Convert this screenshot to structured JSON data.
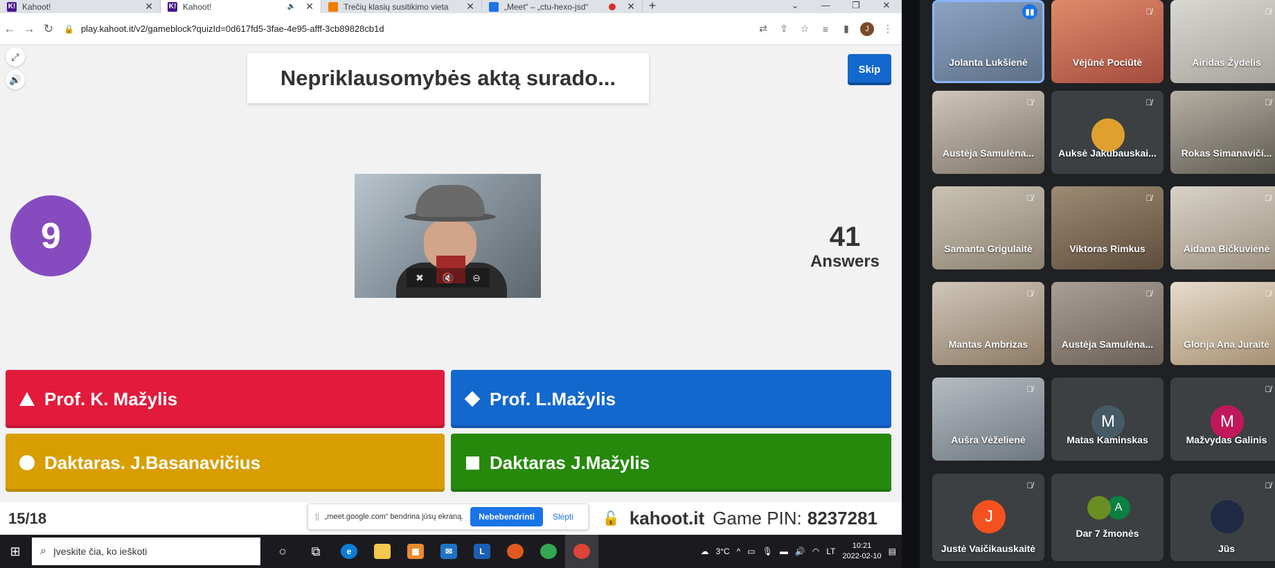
{
  "browser": {
    "tabs": [
      {
        "label": "Kahoot!",
        "favicon": "K!",
        "active": false
      },
      {
        "label": "Kahoot!",
        "favicon": "K!",
        "active": true
      },
      {
        "label": "Trečių klasių susitikimo vieta",
        "favicon": "orange-square-icon",
        "active": false
      },
      {
        "label": "„Meet“ – „ctu-hexo-jsd“",
        "favicon": "meet-icon",
        "active": false
      }
    ],
    "url": "play.kahoot.it/v2/gameblock?quizId=0d617fd5-3fae-4e95-afff-3cb89828cb1d",
    "profile_initial": "J"
  },
  "kahoot": {
    "question": "Nepriklausomybės aktą surado...",
    "skip_label": "Skip",
    "timer": "9",
    "answers_count": "41",
    "answers_label": "Answers",
    "options": [
      {
        "label": "Prof. K. Mažylis",
        "shape": "triangle",
        "color": "#e21b3c"
      },
      {
        "label": "Prof. L.Mažylis",
        "shape": "diamond",
        "color": "#1368ce"
      },
      {
        "label": "Daktaras. J.Basanavičius",
        "shape": "circle",
        "color": "#d89e00"
      },
      {
        "label": "Daktaras J.Mažylis",
        "shape": "square",
        "color": "#26890c"
      }
    ],
    "progress": "15/18",
    "site": "kahoot.it",
    "pin_label": "Game PIN:",
    "pin": "8237281"
  },
  "share_banner": {
    "text": "„meet.google.com“ bendrina jūsų ekraną.",
    "stop_label": "Nebebendrinti",
    "hide_label": "Slėpti"
  },
  "taskbar": {
    "search_placeholder": "Įveskite čia, ko ieškoti",
    "weather": "3°C",
    "lang": "LT",
    "time": "10:21",
    "date": "2022-02-10"
  },
  "meet": {
    "participants": [
      {
        "name": "Jolanta Lukšienė",
        "mic": "active"
      },
      {
        "name": "Vėjūnė Pociūtė",
        "mic": "muted"
      },
      {
        "name": "Airidas Žydelis",
        "mic": "muted"
      },
      {
        "name": "Austėja Samulėna...",
        "mic": "muted"
      },
      {
        "name": "Auksė Jakubauskai...",
        "mic": "muted"
      },
      {
        "name": "Rokas Simanavičí...",
        "mic": "muted"
      },
      {
        "name": "Samanta Grigulaitė",
        "mic": "muted"
      },
      {
        "name": "Viktoras Rimkus",
        "mic": "muted"
      },
      {
        "name": "Aidana Bičkuvienė",
        "mic": "muted"
      },
      {
        "name": "Mantas Ambrizas",
        "mic": "muted"
      },
      {
        "name": "Austėja Samulėna...",
        "mic": "muted"
      },
      {
        "name": "Glorija Ana Juraitė",
        "mic": "muted"
      },
      {
        "name": "Aušra Vėželienė",
        "mic": "muted"
      },
      {
        "name": "Matas Kaminskas",
        "avatar": "M",
        "avatar_color": "#455a64"
      },
      {
        "name": "Mažvydas Galinis",
        "avatar": "M",
        "avatar_color": "#c2185b",
        "mic": "muted"
      },
      {
        "name": "Justė Vaičikauskaitė",
        "avatar": "J",
        "avatar_color": "#f4511e",
        "mic": "muted"
      },
      {
        "name": "Dar 7 žmonės",
        "avatar": "A",
        "avatar_color": "#0b8043"
      },
      {
        "name": "Jūs",
        "mic": "muted"
      }
    ]
  }
}
